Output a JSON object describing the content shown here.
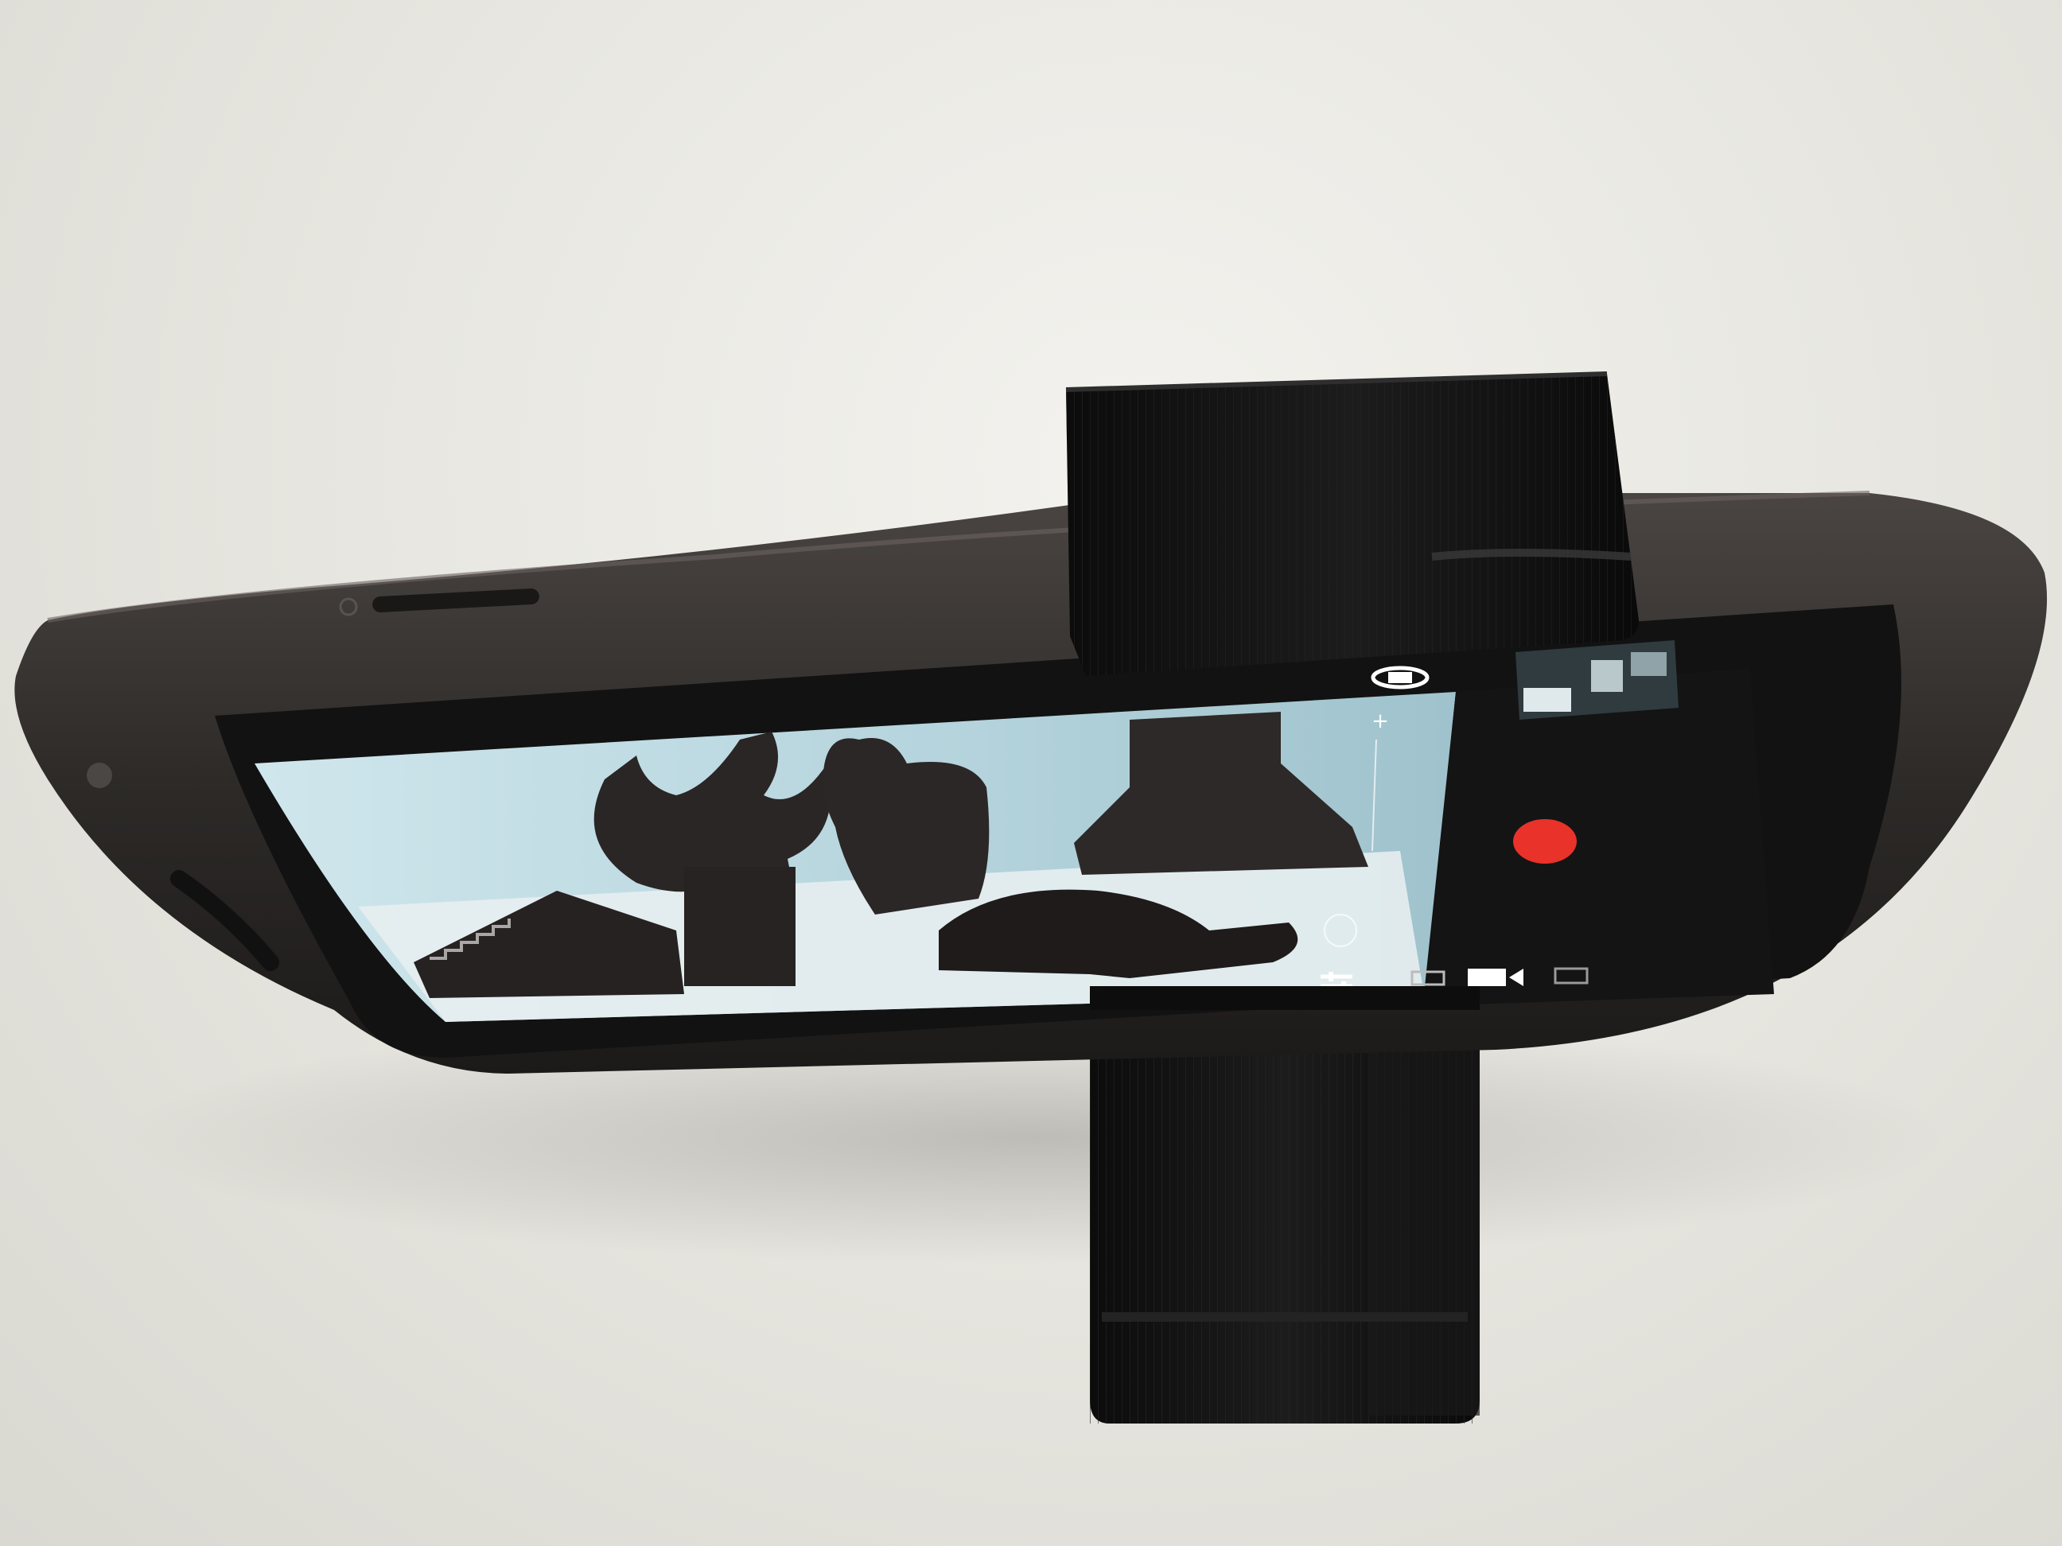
{
  "photo": {
    "subject": "smartphone-in-landscape-stand",
    "colors": {
      "background": "#e9e8e2",
      "phone_body": "#2e2b29",
      "stand": "#111111",
      "screen_sky": "#b9d7df",
      "record_button": "#e8322a"
    }
  },
  "camera_ui": {
    "zoom_plus_label": "+",
    "icons": [
      "switch-camera-icon",
      "thumbnail-preview",
      "record-button",
      "camera-mode-icon",
      "video-mode-icon",
      "panorama-mode-icon",
      "settings-icon",
      "focus-ring-icon"
    ]
  }
}
